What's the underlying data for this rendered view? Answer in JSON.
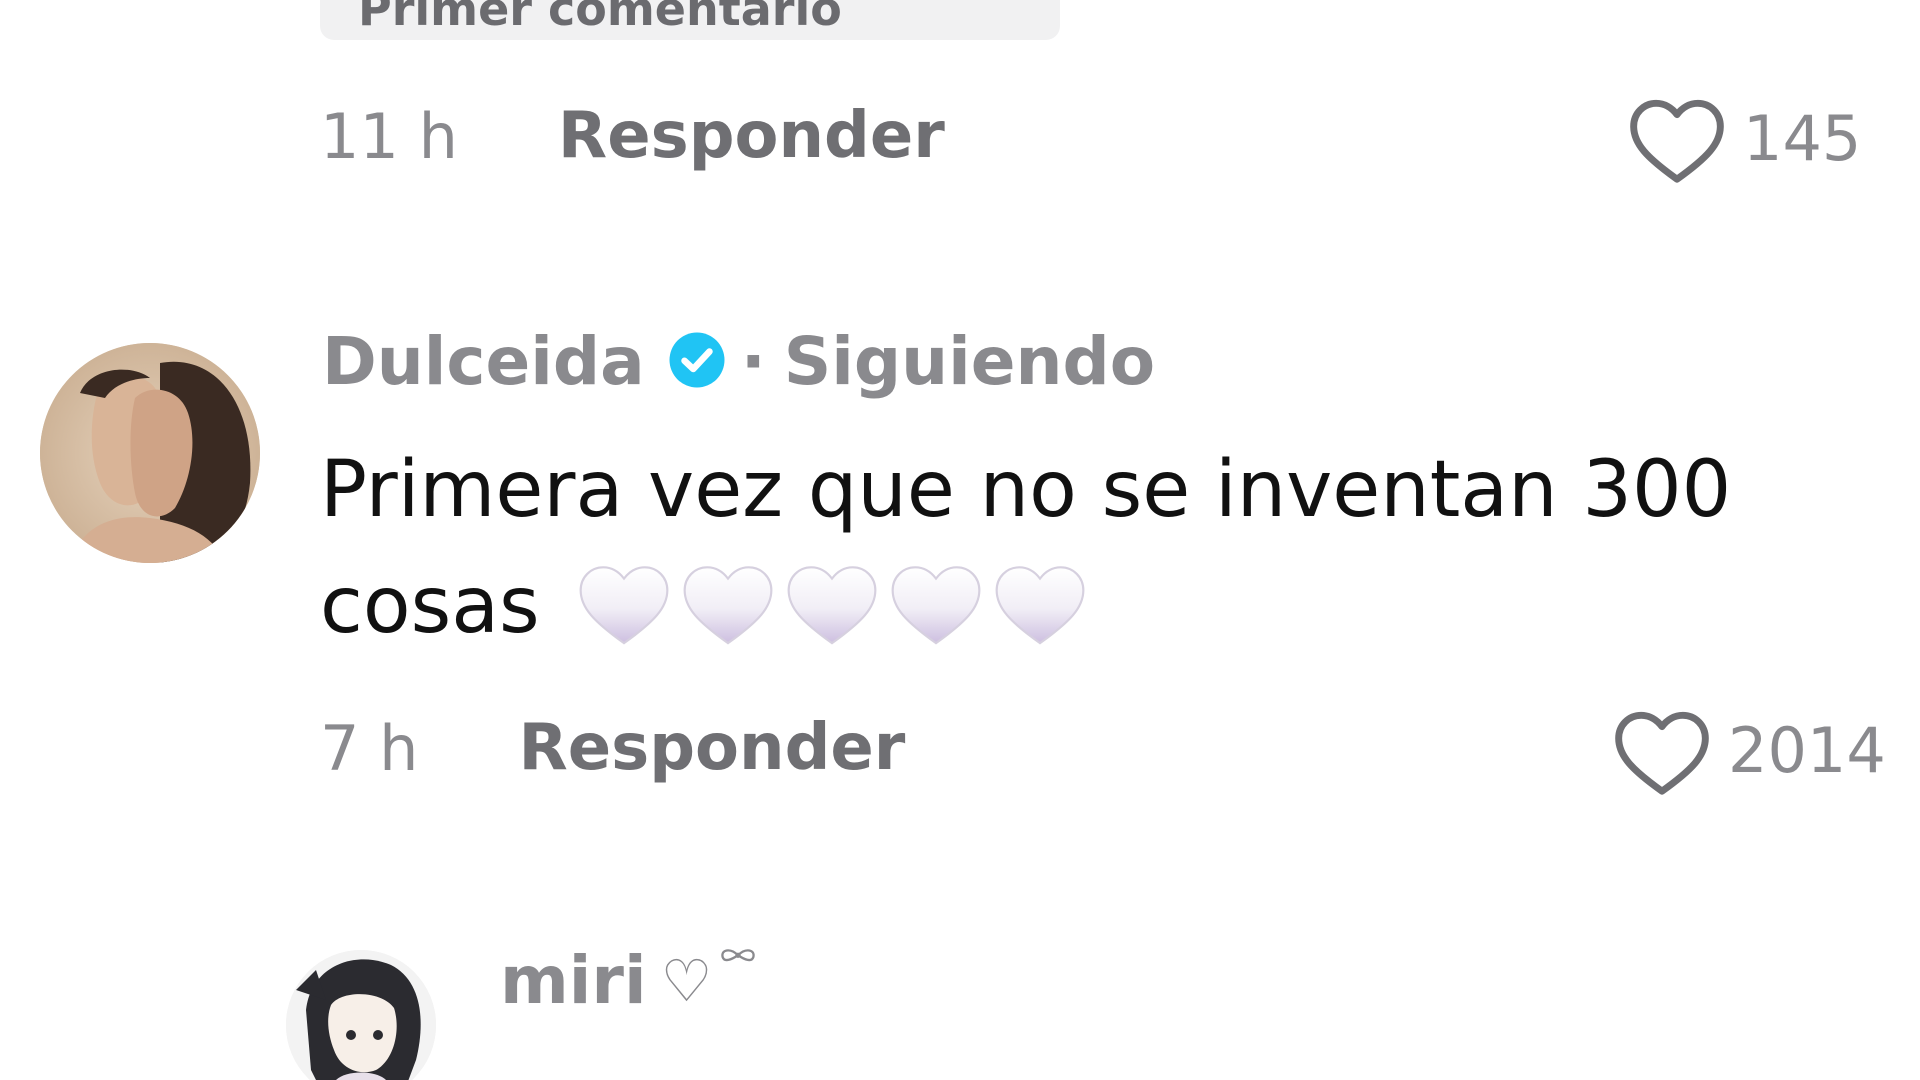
{
  "top_comment": {
    "badge_label": "Primer comentario",
    "time": "11 h",
    "reply_label": "Responder",
    "likes": "145"
  },
  "dulceida_comment": {
    "username": "Dulceida",
    "separator": "·",
    "following_label": "Siguiendo",
    "text": "Primera vez que no se inventan 300 cosas",
    "emoji": [
      "white-heart",
      "white-heart",
      "white-heart",
      "white-heart",
      "white-heart"
    ],
    "time": "7 h",
    "reply_label": "Responder",
    "likes": "2014",
    "verified_color": "#20c4f4"
  },
  "miri_comment": {
    "username": "miri",
    "name_suffix": "♡",
    "text_cut": ""
  },
  "colors": {
    "meta_text": "#8a8a8e",
    "body_text": "#111111",
    "heart_outline": "#6f6f73"
  }
}
